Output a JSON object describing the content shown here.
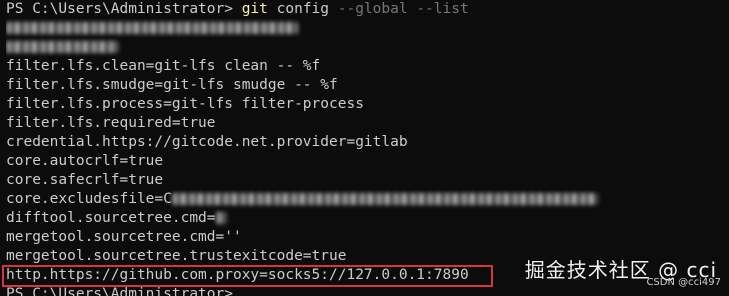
{
  "prompt1": {
    "ps": "PS C:\\Users\\Administrator> ",
    "git": "git",
    "args": " config ",
    "flags": "--global --list"
  },
  "lines": [
    "filter.lfs.clean=git-lfs clean -- %f",
    "filter.lfs.smudge=git-lfs smudge -- %f",
    "filter.lfs.process=git-lfs filter-process",
    "filter.lfs.required=true",
    "credential.https://gitcode.net.provider=gitlab",
    "core.autocrlf=true",
    "core.safecrlf=true",
    "core.excludesfile=C",
    "difftool.sourcetree.cmd=",
    "mergetool.sourcetree.cmd=''",
    "mergetool.sourcetree.trustexitcode=true",
    "http.https://github.com.proxy=socks5://127.0.0.1:7890"
  ],
  "prompt2": "PS C:\\Users\\Administrator> ",
  "watermark": "掘金技术社区 @ cci",
  "credit": "CSDN @cci497",
  "colors": {
    "background": "#0c0c0c",
    "text": "#cccccc",
    "command": "#f9f1a5",
    "flag": "#767676",
    "highlight": "#d9333f"
  }
}
